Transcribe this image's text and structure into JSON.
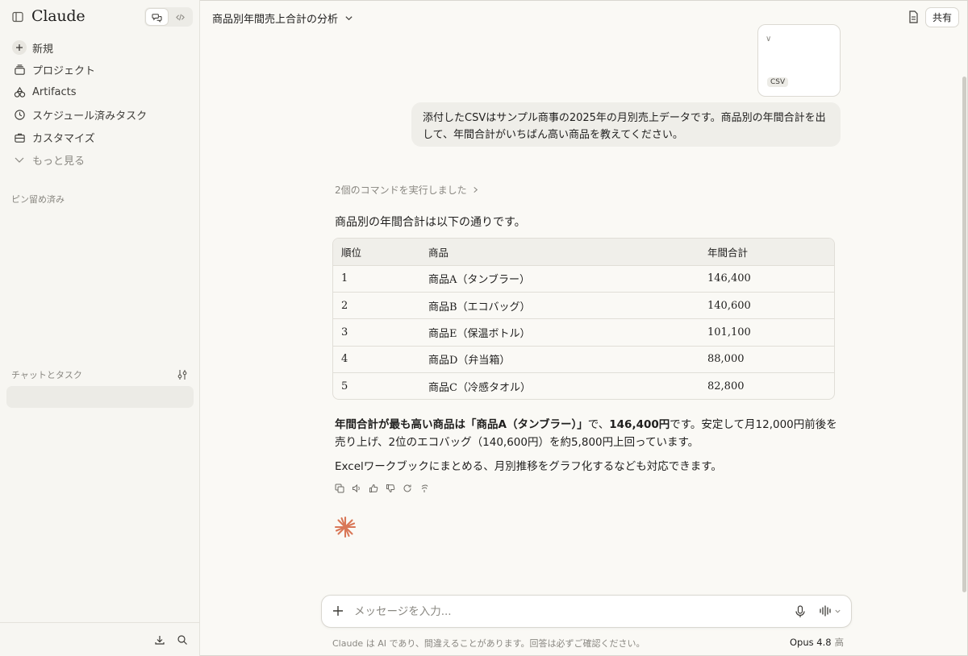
{
  "app": {
    "brand": "Claude"
  },
  "sidebar": {
    "items": [
      {
        "label": "新規",
        "icon": "plus-icon"
      },
      {
        "label": "プロジェクト",
        "icon": "folder-stack-icon"
      },
      {
        "label": "Artifacts",
        "icon": "shapes-icon"
      },
      {
        "label": "スケジュール済みタスク",
        "icon": "clock-icon"
      },
      {
        "label": "カスタマイズ",
        "icon": "briefcase-icon"
      },
      {
        "label": "もっと見る",
        "icon": "chevron-down-icon"
      }
    ],
    "pinned_label": "ピン留め済み",
    "chats_label": "チャットとタスク"
  },
  "header": {
    "title": "商品別年間売上合計の分析",
    "share_label": "共有"
  },
  "attachment": {
    "caret": "∨",
    "type": "CSV"
  },
  "user_message": "添付したCSVはサンプル商事の2025年の月別売上データです。商品別の年間合計を出して、年間合計がいちばん高い商品を教えてください。",
  "assistant": {
    "commands_run": "2個のコマンドを実行しました",
    "intro": "商品別の年間合計は以下の通りです。",
    "table": {
      "headers": [
        "順位",
        "商品",
        "年間合計"
      ],
      "rows": [
        [
          "1",
          "商品A（タンブラー）",
          "146,400"
        ],
        [
          "2",
          "商品B（エコバッグ）",
          "140,600"
        ],
        [
          "3",
          "商品E（保温ボトル）",
          "101,100"
        ],
        [
          "4",
          "商品D（弁当箱）",
          "88,000"
        ],
        [
          "5",
          "商品C（冷感タオル）",
          "82,800"
        ]
      ]
    },
    "summary_bold_1": "年間合計が最も高い商品は「商品A（タンブラー）」",
    "summary_mid": "で、",
    "summary_bold_2": "146,400円",
    "summary_rest": "です。安定して月12,000円前後を売り上げ、2位のエコバッグ（140,600円）を約5,800円上回っています。",
    "followup": "Excelワークブックにまとめる、月別推移をグラフ化するなども対応できます。"
  },
  "composer": {
    "placeholder": "メッセージを入力..."
  },
  "footer": {
    "disclaimer": "Claude は AI であり、間違えることがあります。回答は必ずご確認ください。",
    "model": "Opus 4.8",
    "effort": "高"
  },
  "colors": {
    "accent": "#d97757",
    "background": "#faf9f5",
    "sidebar": "#f7f6f2"
  }
}
